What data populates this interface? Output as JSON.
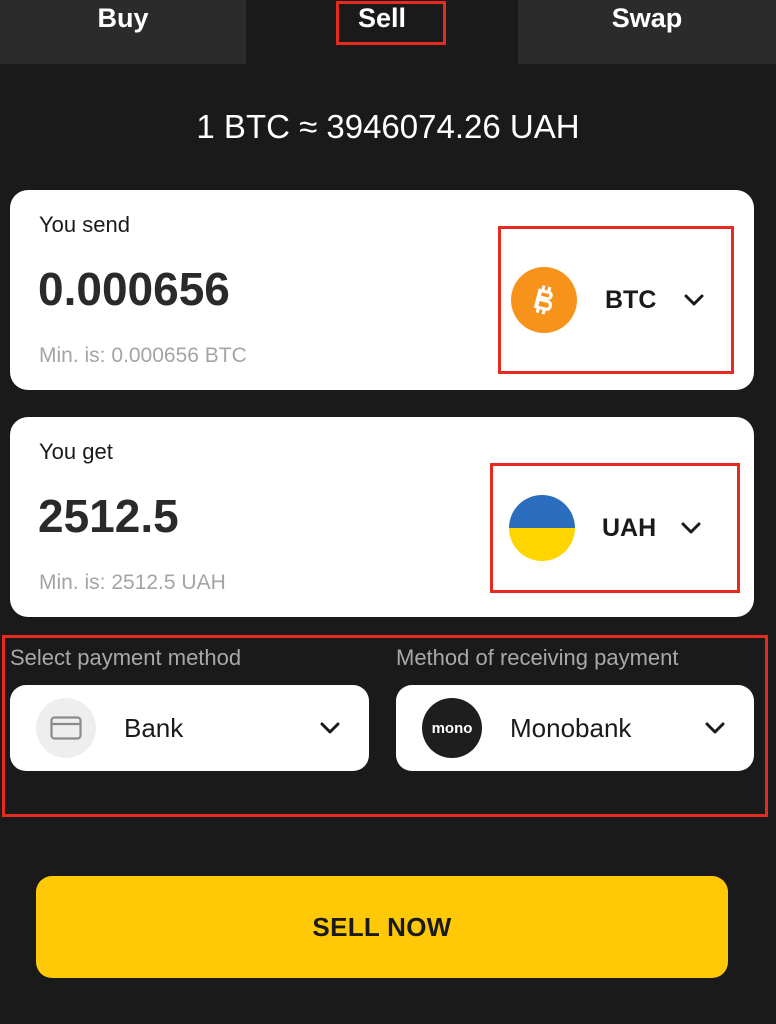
{
  "tabs": {
    "buy": "Buy",
    "sell": "Sell",
    "swap": "Swap",
    "active": "Sell"
  },
  "rate": {
    "text": "1 BTC ≈ 3946074.26 UAH"
  },
  "send": {
    "label": "You send",
    "amount": "0.000656",
    "min": "Min. is: 0.000656 BTC",
    "currency": "BTC",
    "currency_icon": "bitcoin-icon"
  },
  "get": {
    "label": "You get",
    "amount": "2512.5",
    "min": "Min. is: 2512.5 UAH",
    "currency": "UAH",
    "currency_icon": "ukraine-flag-icon"
  },
  "payment": {
    "select_label": "Select payment method",
    "select_value": "Bank",
    "select_icon": "card-icon",
    "receive_label": "Method of receiving payment",
    "receive_value": "Monobank",
    "receive_logo": "mono"
  },
  "action": {
    "sell_now": "SELL NOW"
  },
  "colors": {
    "background": "#1a1a1a",
    "tab_inactive": "#2b2b2b",
    "accent_yellow": "#ffc907",
    "highlight_red": "#e52b20",
    "btc_orange": "#f7931a",
    "flag_blue": "#2a6ebd",
    "flag_yellow": "#ffd500"
  }
}
